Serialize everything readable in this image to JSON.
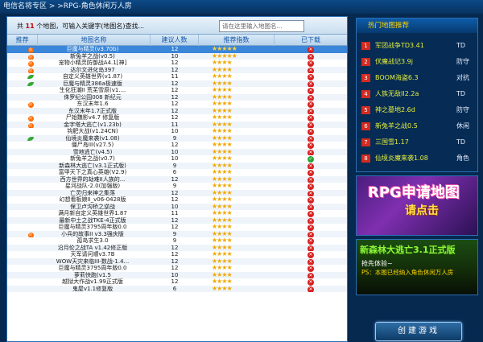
{
  "window": {
    "title": "电信名将专区 > >RPG-角色休闲万人房"
  },
  "hint": {
    "prefix": "共 ",
    "count": "11",
    "suffix": " 个地图，可输入关键字(地图名)查找...",
    "search_placeholder": "请在这里输入地图名..."
  },
  "table": {
    "headers": [
      "推荐",
      "地图名称",
      "建议人数",
      "推荐指数",
      "已下载"
    ],
    "rows": [
      {
        "tag": "hot",
        "name": "巨魔与精灵(v3.70b)",
        "players": "12",
        "stars": 5,
        "dl": "no",
        "selected": true
      },
      {
        "tag": "hot",
        "name": "新兔羊之战(v0.5)",
        "players": "10",
        "stars": 5,
        "dl": "no"
      },
      {
        "tag": "hot",
        "name": "宠物小精灵防御战A4.1[神]",
        "players": "12",
        "stars": 4,
        "dl": "no"
      },
      {
        "tag": "hot",
        "name": "达尔文进化岛397",
        "players": "12",
        "stars": 4,
        "dl": "no"
      },
      {
        "tag": "leaf",
        "name": "自定义英雄世界(v1.87)",
        "players": "11",
        "stars": 4,
        "dl": "no"
      },
      {
        "tag": "leaf",
        "name": "巨魔与精灵386a极速版",
        "players": "12",
        "stars": 4,
        "dl": "no"
      },
      {
        "tag": "",
        "name": "生化狂潮II 荒芜雪原(v1....",
        "players": "12",
        "stars": 4,
        "dl": "no"
      },
      {
        "tag": "",
        "name": "侏罗纪公园008 新纪元",
        "players": "12",
        "stars": 4,
        "dl": "no"
      },
      {
        "tag": "hot",
        "name": "东汉末年1.6",
        "players": "12",
        "stars": 4,
        "dl": "no"
      },
      {
        "tag": "",
        "name": "东汉末年1.7正式版",
        "players": "12",
        "stars": 4,
        "dl": "no"
      },
      {
        "tag": "hot",
        "name": "尸始魏影v4.7 修复版",
        "players": "12",
        "stars": 4,
        "dl": "no"
      },
      {
        "tag": "hot",
        "name": "金字塔大逃亡(v1.23b)",
        "players": "11",
        "stars": 4,
        "dl": "no"
      },
      {
        "tag": "",
        "name": "钩肥大战(v1.24CN)",
        "players": "10",
        "stars": 4,
        "dl": "no"
      },
      {
        "tag": "leaf",
        "name": "仙境炎魔来袭(v1.08)",
        "players": "9",
        "stars": 4,
        "dl": "no"
      },
      {
        "tag": "",
        "name": "僵尸岛III(v27.5)",
        "players": "12",
        "stars": 4,
        "dl": "no"
      },
      {
        "tag": "",
        "name": "雪地逃亡(v4.5)",
        "players": "10",
        "stars": 4,
        "dl": "no"
      },
      {
        "tag": "",
        "name": "新兔羊之战(v0.7)",
        "players": "10",
        "stars": 4,
        "dl": "yes"
      },
      {
        "tag": "",
        "name": "新森林大逃亡(v3.1正式版)",
        "players": "9",
        "stars": 4,
        "dl": "no"
      },
      {
        "tag": "",
        "name": "富甲天下之真心英雄(V2.9)",
        "players": "6",
        "stars": 4,
        "dl": "no"
      },
      {
        "tag": "",
        "name": "西方世界的劫难II人族的...",
        "players": "12",
        "stars": 4,
        "dl": "no"
      },
      {
        "tag": "",
        "name": "星河战队-2.0(加强版)",
        "players": "9",
        "stars": 4,
        "dl": "no"
      },
      {
        "tag": "",
        "name": "亡灵归来神之集落",
        "players": "12",
        "stars": 4,
        "dl": "no"
      },
      {
        "tag": "",
        "name": "幻想看板娘II_v06-0428版",
        "players": "12",
        "stars": 4,
        "dl": "no"
      },
      {
        "tag": "",
        "name": "保卫卢沟桥之逆战",
        "players": "10",
        "stars": 4,
        "dl": "no"
      },
      {
        "tag": "",
        "name": "满月新自定义英雄世界1.87",
        "players": "11",
        "stars": 4,
        "dl": "no"
      },
      {
        "tag": "",
        "name": "最新中土之战TKE-4正式版",
        "players": "12",
        "stars": 4,
        "dl": "no"
      },
      {
        "tag": "",
        "name": "巨魔与精灵3795周年版0.0",
        "players": "12",
        "stars": 4,
        "dl": "no"
      },
      {
        "tag": "hot",
        "name": "小兵的故事II v3.3强庆版",
        "players": "9",
        "stars": 4,
        "dl": "no"
      },
      {
        "tag": "",
        "name": "孤岛求生3.0",
        "players": "9",
        "stars": 4,
        "dl": "no"
      },
      {
        "tag": "",
        "name": "沿月伦之战TA v1.42修正版",
        "players": "12",
        "stars": 4,
        "dl": "no"
      },
      {
        "tag": "",
        "name": "天军请问顺v3.7B",
        "players": "12",
        "stars": 4,
        "dl": "no"
      },
      {
        "tag": "",
        "name": "WOW天灾来临III-数战-1.4...",
        "players": "12",
        "stars": 4,
        "dl": "no"
      },
      {
        "tag": "",
        "name": "巨魔与精灵3795周年版0.0",
        "players": "12",
        "stars": 4,
        "dl": "no"
      },
      {
        "tag": "",
        "name": "萝莉快跑(v1.5",
        "players": "10",
        "stars": 4,
        "dl": "no"
      },
      {
        "tag": "",
        "name": "越狱大作战v1.99正式版",
        "players": "12",
        "stars": 4,
        "dl": "no"
      },
      {
        "tag": "",
        "name": "鬼屋v1.1修复版",
        "players": "6",
        "stars": 4,
        "dl": "no"
      }
    ]
  },
  "hot_maps": {
    "title": "热门地图推荐",
    "items": [
      {
        "rank": "1",
        "name": "军团战争TD3.41",
        "type": "TD"
      },
      {
        "rank": "2",
        "name": "伏魔战记3.9j",
        "type": "防守"
      },
      {
        "rank": "3",
        "name": "BOOM海盗6.3",
        "type": "对抗"
      },
      {
        "rank": "4",
        "name": "人族无敌II2.2a",
        "type": "TD"
      },
      {
        "rank": "5",
        "name": "神之墓地2.6d",
        "type": "防守"
      },
      {
        "rank": "6",
        "name": "新兔羊之战0.5",
        "type": "休闲"
      },
      {
        "rank": "7",
        "name": "三国雪1.17",
        "type": "TD"
      },
      {
        "rank": "8",
        "name": "仙境炎魔来袭1.08",
        "type": "角色"
      }
    ]
  },
  "banners": {
    "rpg_title": "RPG申请地图",
    "rpg_sub": "请点击",
    "forest_title": "新森林大逃亡3.1正式版",
    "forest_line1": "抢先体验~",
    "forest_line2": "PS：本图已经纳入角色休闲万人房"
  },
  "create_button": "创建游戏",
  "colors": {
    "frame": "#06294f",
    "selected_row": "#3a86d8",
    "star": "#f2a800",
    "rank_red": "#d42a1f",
    "hot_name": "#e4ef3c"
  }
}
